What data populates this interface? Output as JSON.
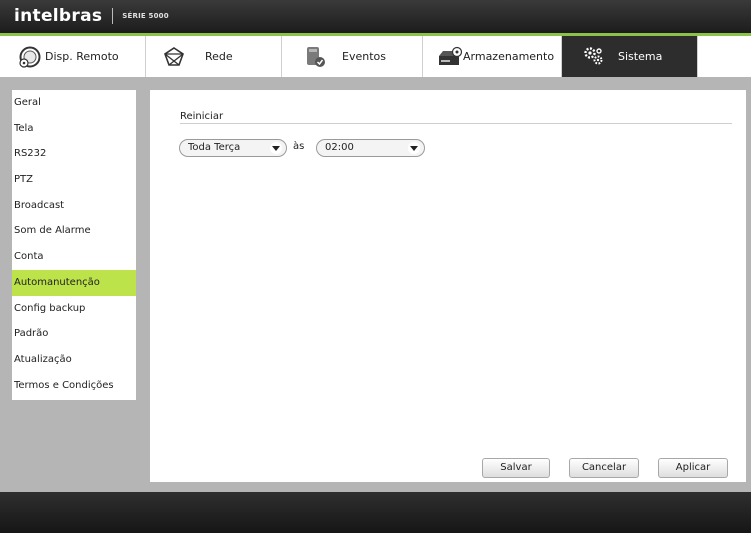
{
  "header": {
    "brand": "intelbras",
    "series": "SÉRIE 5000"
  },
  "tabs": [
    {
      "label": "Disp. Remoto",
      "icon": "remote-device-icon",
      "active": false
    },
    {
      "label": "Rede",
      "icon": "network-icon",
      "active": false
    },
    {
      "label": "Eventos",
      "icon": "events-icon",
      "active": false
    },
    {
      "label": "Armazenamento",
      "icon": "storage-icon",
      "active": false
    },
    {
      "label": "Sistema",
      "icon": "gears-icon",
      "active": true
    }
  ],
  "sidebar": {
    "items": [
      {
        "label": "Geral"
      },
      {
        "label": "Tela"
      },
      {
        "label": "RS232"
      },
      {
        "label": "PTZ"
      },
      {
        "label": "Broadcast"
      },
      {
        "label": "Som de Alarme"
      },
      {
        "label": "Conta"
      },
      {
        "label": "Automanutenção",
        "active": true
      },
      {
        "label": "Config backup"
      },
      {
        "label": "Padrão"
      },
      {
        "label": "Atualização"
      },
      {
        "label": "Termos e Condições"
      }
    ]
  },
  "main": {
    "section_title": "Reiniciar",
    "day_select": {
      "value": "Toda Terça"
    },
    "at_label": "às",
    "time_select": {
      "value": "02:00"
    },
    "buttons": {
      "save": "Salvar",
      "cancel": "Cancelar",
      "apply": "Aplicar"
    }
  },
  "colors": {
    "accent": "#bde34a",
    "tab_border": "#8bc34a",
    "active_tab": "#2d2d2d",
    "workspace": "#b5b5b5"
  }
}
